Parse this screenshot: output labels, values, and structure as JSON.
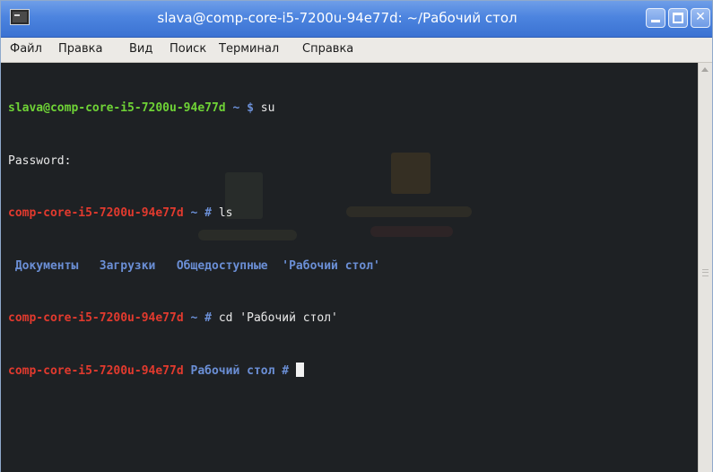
{
  "window": {
    "title": "slava@comp-core-i5-7200u-94e77d: ~/Рабочий стол",
    "minimize_icon": "minimize-icon",
    "maximize_icon": "maximize-icon",
    "close_icon": "close-icon",
    "close_glyph": "✕",
    "title_bar_color": "#4c84df"
  },
  "menubar": {
    "items": [
      "Файл",
      "Правка",
      "Вид",
      "Поиск",
      "Терминал",
      "Справка"
    ]
  },
  "terminal": {
    "colors": {
      "user_prompt": "#6fd336",
      "root_prompt": "#e23a2e",
      "directory": "#6b8fd6",
      "text": "#e8e8e8",
      "background": "#1e2124"
    },
    "lines": [
      {
        "host": "slava@comp-core-i5-7200u-94e77d",
        "path": " ~ $ ",
        "command": "su"
      },
      {
        "text": "Password:"
      },
      {
        "host": "comp-core-i5-7200u-94e77d",
        "path": " ~ # ",
        "command": "ls"
      },
      {
        "listing": [
          " Документы",
          "   Загрузки",
          "   Общедоступные",
          "  'Рабочий стол'"
        ]
      },
      {
        "host": "comp-core-i5-7200u-94e77d",
        "path": " ~ # ",
        "command": "cd 'Рабочий стол'"
      },
      {
        "host": "comp-core-i5-7200u-94e77d",
        "path": " Рабочий стол # ",
        "command": ""
      }
    ]
  }
}
